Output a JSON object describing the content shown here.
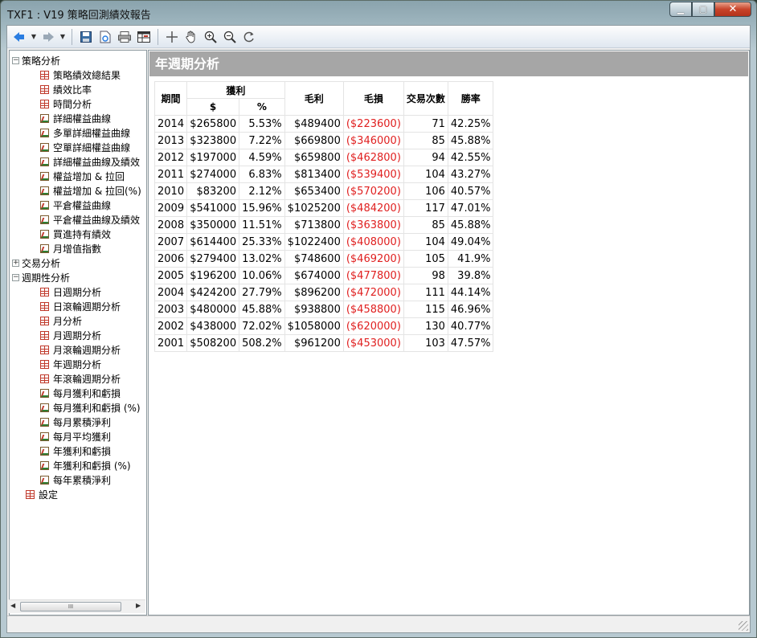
{
  "window": {
    "title": "TXF1 : V19 策略回測績效報告",
    "buttons": {
      "minimize": "▁",
      "maximize": "▢",
      "close": "✕"
    }
  },
  "toolbar": {
    "icons": [
      "back-icon",
      "back-dropdown-icon",
      "forward-icon",
      "forward-dropdown-icon",
      "save-icon",
      "export-icon",
      "print-icon",
      "table-view-icon",
      "crosshair-icon",
      "hand-pan-icon",
      "zoom-in-icon",
      "zoom-out-icon",
      "reset-zoom-icon"
    ]
  },
  "tree": {
    "items": [
      {
        "label": "策略分析",
        "level": 0,
        "expander": "−",
        "icon": ""
      },
      {
        "label": "策略績效總結果",
        "level": 1,
        "icon": "grid"
      },
      {
        "label": "績效比率",
        "level": 1,
        "icon": "grid"
      },
      {
        "label": "時間分析",
        "level": 1,
        "icon": "grid"
      },
      {
        "label": "詳細權益曲線",
        "level": 1,
        "icon": "chart"
      },
      {
        "label": "多單詳細權益曲線",
        "level": 1,
        "icon": "chart"
      },
      {
        "label": "空單詳細權益曲線",
        "level": 1,
        "icon": "chart"
      },
      {
        "label": "詳細權益曲線及績效",
        "level": 1,
        "icon": "chart"
      },
      {
        "label": "權益增加 & 拉回",
        "level": 1,
        "icon": "chart"
      },
      {
        "label": "權益增加 & 拉回(%)",
        "level": 1,
        "icon": "chart"
      },
      {
        "label": "平倉權益曲線",
        "level": 1,
        "icon": "chart"
      },
      {
        "label": "平倉權益曲線及績效",
        "level": 1,
        "icon": "chart"
      },
      {
        "label": "買進持有績效",
        "level": 1,
        "icon": "chart"
      },
      {
        "label": "月增值指數",
        "level": 1,
        "icon": "chart"
      },
      {
        "label": "交易分析",
        "level": 0,
        "expander": "+",
        "icon": ""
      },
      {
        "label": "週期性分析",
        "level": 0,
        "expander": "−",
        "icon": ""
      },
      {
        "label": "日週期分析",
        "level": 1,
        "icon": "grid"
      },
      {
        "label": "日滾輪週期分析",
        "level": 1,
        "icon": "grid"
      },
      {
        "label": "月分析",
        "level": 1,
        "icon": "grid"
      },
      {
        "label": "月週期分析",
        "level": 1,
        "icon": "grid"
      },
      {
        "label": "月滾輪週期分析",
        "level": 1,
        "icon": "grid"
      },
      {
        "label": "年週期分析",
        "level": 1,
        "icon": "grid"
      },
      {
        "label": "年滾輪週期分析",
        "level": 1,
        "icon": "grid"
      },
      {
        "label": "每月獲利和虧損",
        "level": 1,
        "icon": "chart"
      },
      {
        "label": "每月獲利和虧損 (%)",
        "level": 1,
        "icon": "chart"
      },
      {
        "label": "每月累積淨利",
        "level": 1,
        "icon": "chart"
      },
      {
        "label": "每月平均獲利",
        "level": 1,
        "icon": "chart"
      },
      {
        "label": "年獲利和虧損",
        "level": 1,
        "icon": "chart"
      },
      {
        "label": "年獲利和虧損 (%)",
        "level": 1,
        "icon": "chart"
      },
      {
        "label": "每年累積淨利",
        "level": 1,
        "icon": "chart"
      },
      {
        "label": "設定",
        "level": 0,
        "expander": "",
        "icon": "grid"
      }
    ],
    "scroll_thumb_label": "III"
  },
  "report": {
    "title": "年週期分析",
    "headers": {
      "period": "期間",
      "profit": "獲利",
      "profit_dollar": "$",
      "profit_pct": "%",
      "gross_profit": "毛利",
      "gross_loss": "毛損",
      "trades": "交易次數",
      "win_rate": "勝率"
    },
    "rows": [
      {
        "period": "2014",
        "profit": "$265800",
        "pct": "5.53%",
        "gross_profit": "$489400",
        "gross_loss": "($223600)",
        "trades": "71",
        "win_rate": "42.25%"
      },
      {
        "period": "2013",
        "profit": "$323800",
        "pct": "7.22%",
        "gross_profit": "$669800",
        "gross_loss": "($346000)",
        "trades": "85",
        "win_rate": "45.88%"
      },
      {
        "period": "2012",
        "profit": "$197000",
        "pct": "4.59%",
        "gross_profit": "$659800",
        "gross_loss": "($462800)",
        "trades": "94",
        "win_rate": "42.55%"
      },
      {
        "period": "2011",
        "profit": "$274000",
        "pct": "6.83%",
        "gross_profit": "$813400",
        "gross_loss": "($539400)",
        "trades": "104",
        "win_rate": "43.27%"
      },
      {
        "period": "2010",
        "profit": "$83200",
        "pct": "2.12%",
        "gross_profit": "$653400",
        "gross_loss": "($570200)",
        "trades": "106",
        "win_rate": "40.57%"
      },
      {
        "period": "2009",
        "profit": "$541000",
        "pct": "15.96%",
        "gross_profit": "$1025200",
        "gross_loss": "($484200)",
        "trades": "117",
        "win_rate": "47.01%"
      },
      {
        "period": "2008",
        "profit": "$350000",
        "pct": "11.51%",
        "gross_profit": "$713800",
        "gross_loss": "($363800)",
        "trades": "85",
        "win_rate": "45.88%"
      },
      {
        "period": "2007",
        "profit": "$614400",
        "pct": "25.33%",
        "gross_profit": "$1022400",
        "gross_loss": "($408000)",
        "trades": "104",
        "win_rate": "49.04%"
      },
      {
        "period": "2006",
        "profit": "$279400",
        "pct": "13.02%",
        "gross_profit": "$748600",
        "gross_loss": "($469200)",
        "trades": "105",
        "win_rate": "41.9%"
      },
      {
        "period": "2005",
        "profit": "$196200",
        "pct": "10.06%",
        "gross_profit": "$674000",
        "gross_loss": "($477800)",
        "trades": "98",
        "win_rate": "39.8%"
      },
      {
        "period": "2004",
        "profit": "$424200",
        "pct": "27.79%",
        "gross_profit": "$896200",
        "gross_loss": "($472000)",
        "trades": "111",
        "win_rate": "44.14%"
      },
      {
        "period": "2003",
        "profit": "$480000",
        "pct": "45.88%",
        "gross_profit": "$938800",
        "gross_loss": "($458800)",
        "trades": "115",
        "win_rate": "46.96%"
      },
      {
        "period": "2002",
        "profit": "$438000",
        "pct": "72.02%",
        "gross_profit": "$1058000",
        "gross_loss": "($620000)",
        "trades": "130",
        "win_rate": "40.77%"
      },
      {
        "period": "2001",
        "profit": "$508200",
        "pct": "508.2%",
        "gross_profit": "$961200",
        "gross_loss": "($453000)",
        "trades": "103",
        "win_rate": "47.57%"
      }
    ]
  },
  "colors": {
    "negative": "#e02020",
    "header_bar": "#a6a6a6"
  }
}
